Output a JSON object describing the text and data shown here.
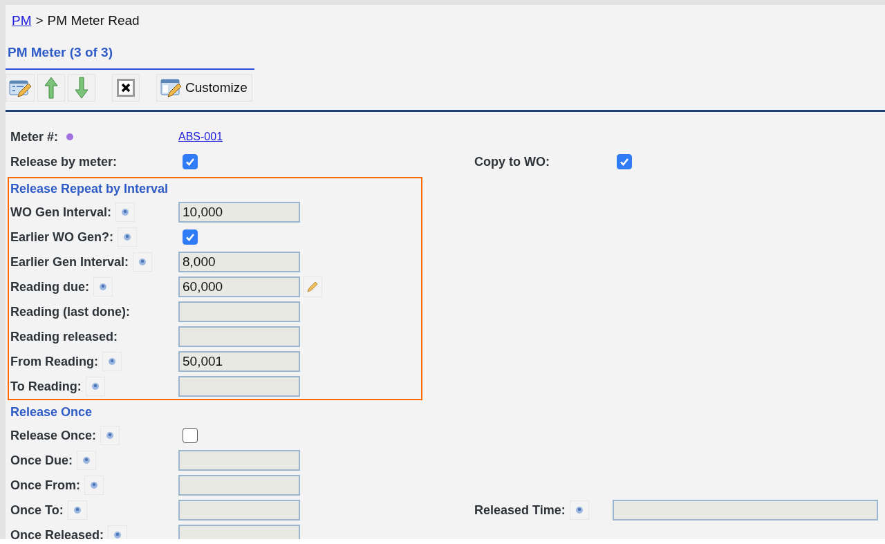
{
  "breadcrumb": {
    "link": "PM",
    "separator": ">",
    "current": "PM Meter Read"
  },
  "title": "PM Meter (3 of 3)",
  "toolbar": [
    {
      "kind": "edit"
    },
    {
      "kind": "up"
    },
    {
      "kind": "down"
    },
    {
      "kind": "delete"
    },
    {
      "kind": "customize",
      "label": "Customize"
    }
  ],
  "sections": [
    {
      "highlighted": false,
      "rows": [
        {
          "label": "Meter #:",
          "help": false,
          "kind": "link",
          "value": "ABS-001",
          "dot": true
        },
        {
          "label": "Release by meter:",
          "help": false,
          "kind": "checkbox",
          "checked": true,
          "right": {
            "label": "Copy to WO:",
            "kind": "checkbox",
            "checked": true
          }
        }
      ]
    },
    {
      "title": "Release Repeat by Interval",
      "highlighted": true,
      "rows": [
        {
          "label": "WO Gen Interval:",
          "help": true,
          "kind": "field",
          "value": "10,000"
        },
        {
          "label": "Earlier WO Gen?:",
          "help": true,
          "kind": "checkbox",
          "checked": true
        },
        {
          "label": "Earlier Gen Interval:",
          "help": true,
          "kind": "field",
          "value": "8,000"
        },
        {
          "label": "Reading due:",
          "help": true,
          "kind": "field",
          "value": "60,000",
          "editable": true
        },
        {
          "label": "Reading (last done):",
          "help": false,
          "kind": "field"
        },
        {
          "label": "Reading released:",
          "help": false,
          "kind": "field"
        },
        {
          "label": "From Reading:",
          "help": true,
          "kind": "field",
          "value": "50,001"
        },
        {
          "label": "To Reading:",
          "help": true,
          "kind": "field"
        }
      ]
    },
    {
      "title": "Release Once",
      "highlighted": false,
      "rows": [
        {
          "label": "Release Once:",
          "help": true,
          "kind": "checkbox",
          "checked": false
        },
        {
          "label": "Once Due:",
          "help": true,
          "kind": "field"
        },
        {
          "label": "Once From:",
          "help": true,
          "kind": "field"
        },
        {
          "label": "Once To:",
          "help": true,
          "kind": "field",
          "right": {
            "label": "Released Time:",
            "help": true,
            "kind": "field"
          }
        },
        {
          "label": "Once Released:",
          "help": true,
          "kind": "field"
        }
      ]
    }
  ]
}
